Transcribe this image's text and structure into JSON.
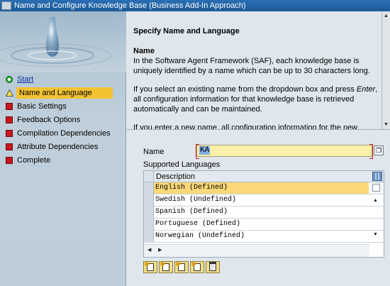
{
  "window": {
    "title": "Name and Configure Knowledge Base (Business Add-In Approach)"
  },
  "sidebar": {
    "items": [
      {
        "label": "Start",
        "status": "complete",
        "link": true
      },
      {
        "label": "Name and Language",
        "status": "current",
        "active": true
      },
      {
        "label": "Basic Settings",
        "status": "pending"
      },
      {
        "label": "Feedback Options",
        "status": "pending"
      },
      {
        "label": "Compilation Dependencies",
        "status": "pending"
      },
      {
        "label": "Attribute Dependencies",
        "status": "pending"
      },
      {
        "label": "Complete",
        "status": "pending"
      }
    ]
  },
  "description": {
    "heading": "Specify Name and Language",
    "subheading": "Name",
    "paragraphs": [
      "In the Software Agent Framework (SAF), each knowledge base is uniquely identified by a name which can be up to 30 characters long.",
      "If you select an existing name from the dropdown box and press Enter, all configuration information for that knowledge base is retrieved automatically and can be maintained.",
      "If you enter a new name, all configuration information for the new"
    ]
  },
  "form": {
    "name_label": "Name",
    "name_value": "KA",
    "supported_languages_label": "Supported Languages",
    "table": {
      "columns": [
        "Description"
      ],
      "rows": [
        {
          "description": "English (Defined)",
          "selected": true
        },
        {
          "description": "Swedish (Undefined)",
          "selected": false
        },
        {
          "description": "Spanish (Defined)",
          "selected": false
        },
        {
          "description": "Portuguese (Defined)",
          "selected": false
        },
        {
          "description": "Norwegian (Undefined)",
          "selected": false
        }
      ]
    }
  },
  "toolbar": {
    "buttons": [
      "insert-row-icon",
      "append-row-icon",
      "copy-row-icon",
      "paste-row-icon",
      "delete-row-icon"
    ]
  },
  "colors": {
    "title_bar": "#1c5a97",
    "active_item": "#f2c232",
    "required_field": "#fbf0a7",
    "selected_row": "#fbd878",
    "status_complete": "#22a02a",
    "status_pending": "#c8161d"
  }
}
